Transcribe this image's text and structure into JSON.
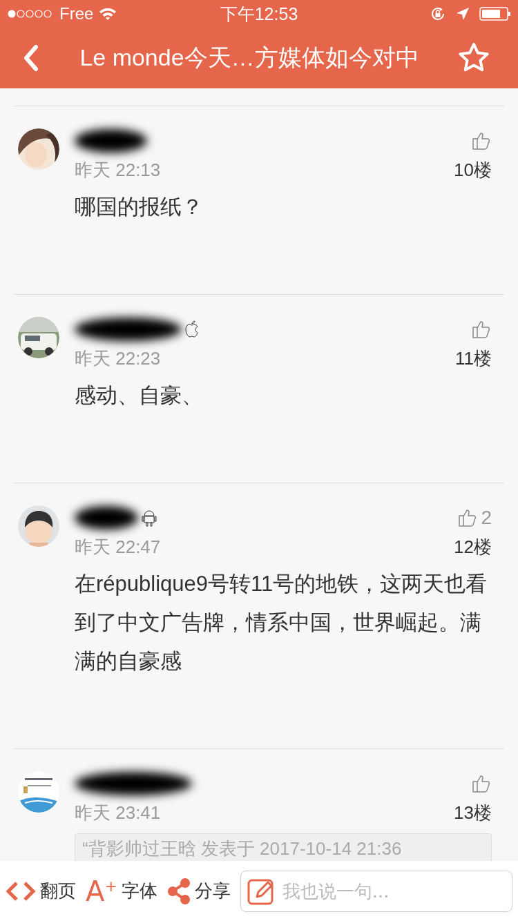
{
  "status_bar": {
    "carrier": "Free",
    "time": "下午12:53"
  },
  "header": {
    "title": "Le monde今天…方媒体如今对中",
    "starred": false
  },
  "comments": [
    {
      "kind": "plain",
      "time": "昨天 22:13",
      "floor": "10楼",
      "text": "哪国的报纸？"
    },
    {
      "kind": "apple",
      "time": "昨天 22:23",
      "floor": "11楼",
      "text": "感动、自豪、"
    },
    {
      "kind": "android",
      "time": "昨天 22:47",
      "like_count": "2",
      "floor": "12楼",
      "text": "在république9号转11号的地铁，这两天也看到了中文广告牌，情系中国，世界崛起。满满的自豪感"
    },
    {
      "kind": "plain",
      "time": "昨天 23:41",
      "floor": "13楼",
      "quote": "“背影帅过王晗 发表于 2017-10-14 21:36"
    }
  ],
  "bottom_bar": {
    "items": [
      {
        "kind": "page",
        "label": "翻页"
      },
      {
        "kind": "font",
        "icon_text": "A$^{+}$",
        "label": "字体"
      },
      {
        "kind": "share",
        "label": "分享"
      }
    ],
    "input": {
      "placeholder": "我也说一句..."
    }
  }
}
